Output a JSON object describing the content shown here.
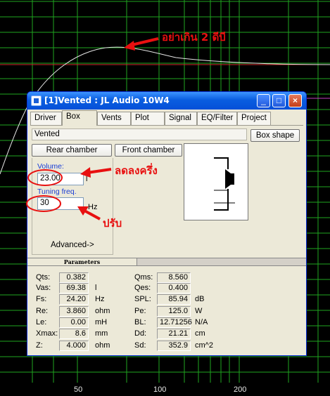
{
  "graph": {
    "x_ticks": [
      "50",
      "100",
      "200"
    ],
    "grid_color": "#1fa61f",
    "curve_color": "#e6e6e6",
    "ref_line_color": "#d02a2a",
    "ref_line2_color": "#c040c0"
  },
  "annotations": {
    "top_note": "อย่าเกิน 2 ดีบี",
    "mid_note": "ลดลงครึ่ง",
    "bottom_note": "ปรับ",
    "color": "#e81010"
  },
  "window": {
    "title": "[1]Vented : JL Audio 10W4",
    "tabs": [
      "Driver",
      "Box",
      "Vents",
      "Plot",
      "Signal",
      "EQ/Filter",
      "Project"
    ],
    "active_tab": "Box"
  },
  "box": {
    "type_label": "Vented",
    "box_shape_button": "Box shape",
    "rear_chamber_button": "Rear chamber",
    "front_chamber_button": "Front chamber",
    "volume_label": "Volume:",
    "volume_value": "23.00",
    "volume_unit": "l",
    "tuning_label": "Tuning freq.",
    "tuning_value": "30",
    "tuning_unit": "Hz",
    "advanced_label": "Advanced->"
  },
  "parameters": {
    "title": "Parameters",
    "left": [
      {
        "label": "Qts:",
        "value": "0.382",
        "unit": ""
      },
      {
        "label": "Vas:",
        "value": "69.38",
        "unit": "l"
      },
      {
        "label": "Fs:",
        "value": "24.20",
        "unit": "Hz"
      },
      {
        "label": "Re:",
        "value": "3.860",
        "unit": "ohm"
      },
      {
        "label": "Le:",
        "value": "0.00",
        "unit": "mH"
      },
      {
        "label": "Xmax:",
        "value": "8.6",
        "unit": "mm"
      },
      {
        "label": "Z:",
        "value": "4.000",
        "unit": "ohm"
      }
    ],
    "right": [
      {
        "label": "Qms:",
        "value": "8.560",
        "unit": ""
      },
      {
        "label": "Qes:",
        "value": "0.400",
        "unit": ""
      },
      {
        "label": "SPL:",
        "value": "85.94",
        "unit": "dB"
      },
      {
        "label": "Pe:",
        "value": "125.0",
        "unit": "W"
      },
      {
        "label": "BL:",
        "value": "12.71256",
        "unit": "N/A"
      },
      {
        "label": "Dd:",
        "value": "21.21",
        "unit": "cm"
      },
      {
        "label": "Sd:",
        "value": "352.9",
        "unit": "cm^2"
      }
    ]
  }
}
